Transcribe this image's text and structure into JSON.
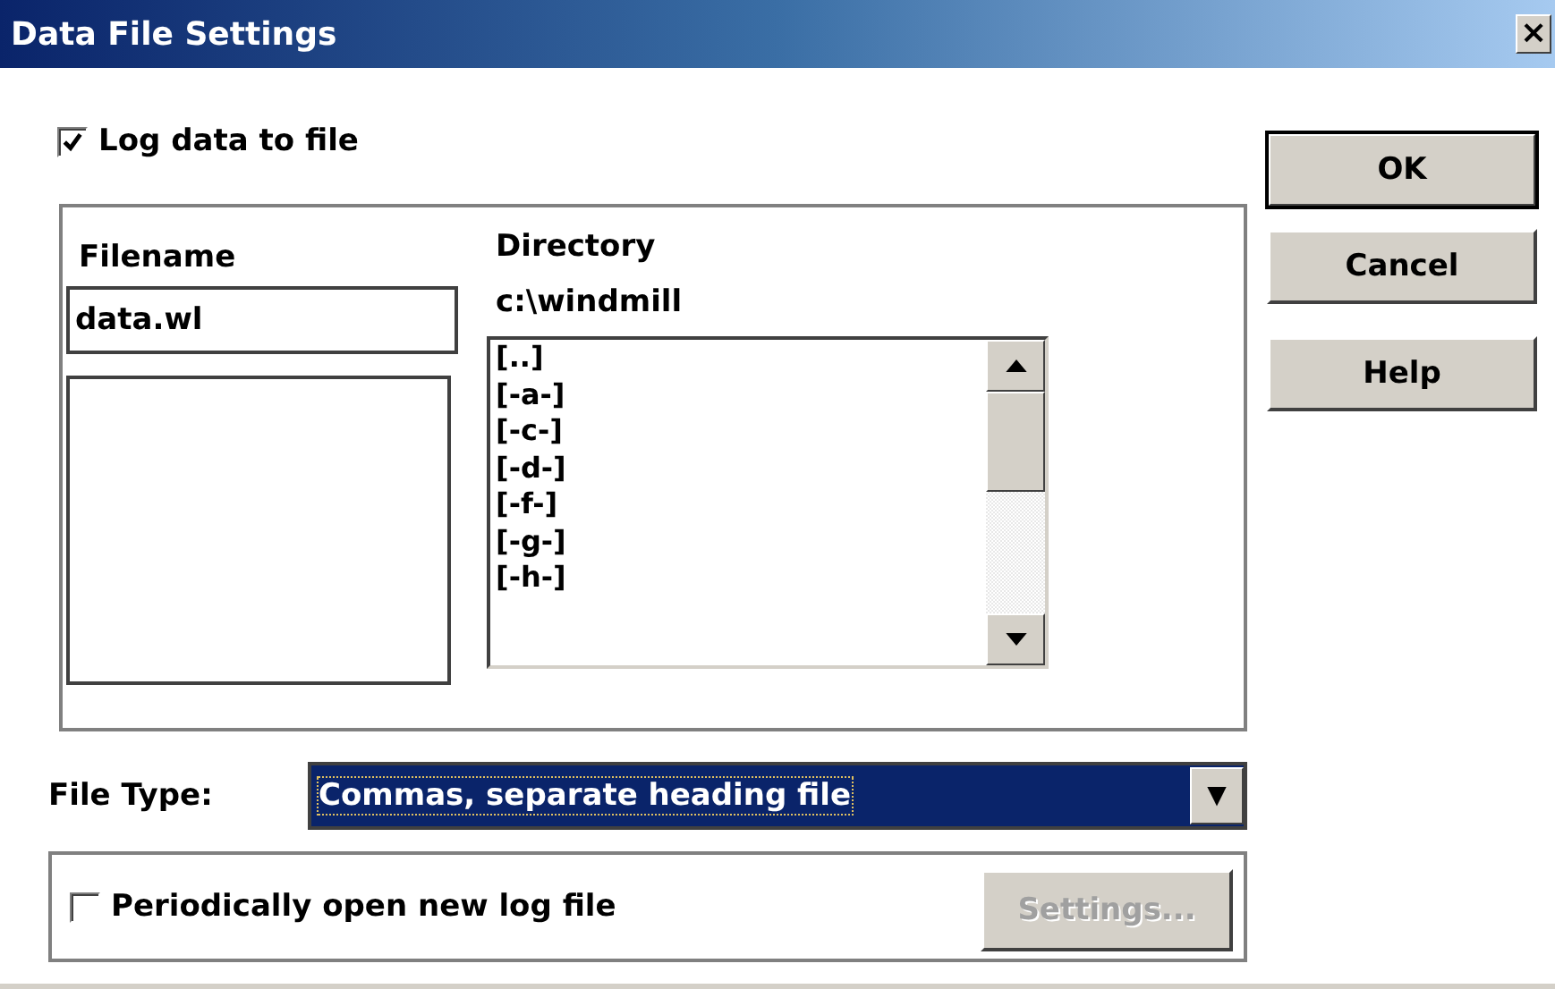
{
  "window": {
    "title": "Data File Settings",
    "close": "×"
  },
  "log_to_file": {
    "label": "Log data to file",
    "checked": true
  },
  "filename": {
    "label": "Filename",
    "value": "data.wl"
  },
  "directory": {
    "label": "Directory",
    "path": "c:\\windmill",
    "items": [
      "[..]",
      "[-a-]",
      "[-c-]",
      "[-d-]",
      "[-f-]",
      "[-g-]",
      "[-h-]"
    ]
  },
  "buttons": [
    {
      "label": "OK",
      "default": true
    },
    {
      "label": "Cancel",
      "default": false
    },
    {
      "label": "Help",
      "default": false
    }
  ],
  "file_type": {
    "label": "File Type:",
    "value": "Commas, separate heading file",
    "arrow": "▼"
  },
  "periodic": {
    "label": "Periodically open new log file",
    "checked": false
  },
  "settings_button": {
    "label": "Settings...",
    "disabled": true
  }
}
